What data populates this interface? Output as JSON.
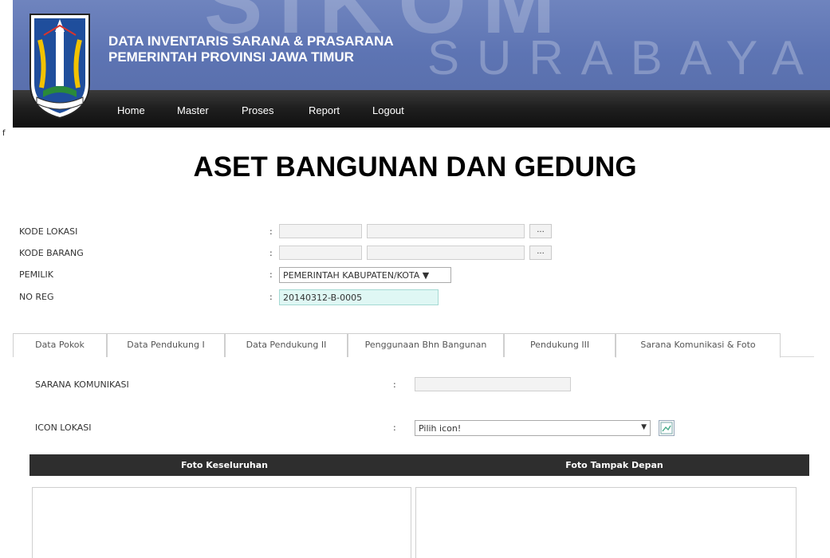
{
  "header": {
    "watermark_top": "SIKOM",
    "watermark_city": "SURABAYA",
    "title_line1": "DATA INVENTARIS SARANA & PRASARANA",
    "title_line2": "PEMERINTAH PROVINSI JAWA TIMUR"
  },
  "nav": {
    "items": [
      "Home",
      "Master",
      "Proses",
      "Report",
      "Logout"
    ]
  },
  "stray_text": "f",
  "page_title": "ASET BANGUNAN DAN GEDUNG",
  "form": {
    "kode_lokasi_label": "KODE LOKASI",
    "kode_barang_label": "KODE BARANG",
    "pemilik_label": "PEMILIK",
    "no_reg_label": "NO REG",
    "colon": ":",
    "dots_button": "...",
    "pemilik_value": "PEMERINTAH KABUPATEN/KOTA ▼",
    "no_reg_value": "20140312-B-0005"
  },
  "tabs": [
    "Data Pokok",
    "Data Pendukung I",
    "Data Pendukung II",
    "Penggunaan Bhn Bangunan",
    "Pendukung III",
    "Sarana Komunikasi & Foto"
  ],
  "active_tab": "Sarana Komunikasi & Foto",
  "section": {
    "sarana_label": "SARANA KOMUNIKASI",
    "icon_label": "ICON LOKASI",
    "icon_select_value": "Pilih icon!",
    "foto_keseluruhan": "Foto Keseluruhan",
    "foto_tampak_depan": "Foto Tampak Depan"
  },
  "colors": {
    "banner": "#5d74b3",
    "navbar": "#1f1f1f",
    "noreg_bg": "#dff7f4",
    "table_header": "#2e2e2e"
  }
}
